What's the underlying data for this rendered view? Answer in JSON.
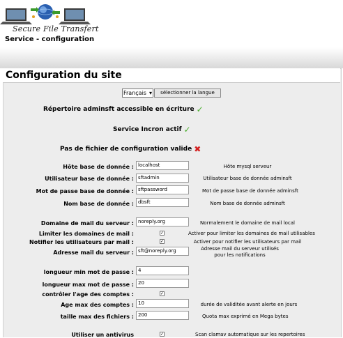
{
  "header": {
    "logo_text": "Secure File Transfert",
    "subtitle": "Service - configuration"
  },
  "panel": {
    "title": "Configuration du site",
    "language": {
      "selected": "Français",
      "button": "sélectionner la langue"
    }
  },
  "status": [
    {
      "text": "Répertoire adminsft accessible en écriture",
      "state": "ok",
      "icon": "check-icon"
    },
    {
      "text": "Service Incron actif",
      "state": "ok",
      "icon": "check-icon"
    },
    {
      "text": "Pas de fichier de configuration valide",
      "state": "error",
      "icon": "cross-icon"
    }
  ],
  "db": {
    "host": {
      "label": "Hôte base de donnée :",
      "value": "localhost",
      "help": "Hôte mysql serveur"
    },
    "user": {
      "label": "Utilisateur base de donnée :",
      "value": "sftadmin",
      "help": "Utilisateur base de donnée adminsft"
    },
    "password": {
      "label": "Mot de passe base de donnée :",
      "value": "sftpassword",
      "help": "Mot de passe base de donnée adminsft"
    },
    "name": {
      "label": "Nom base de donnée :",
      "value": "dbsft",
      "help": "Nom base de donnée adminsft"
    }
  },
  "mail": {
    "domain": {
      "label": "Domaine de mail du serveur :",
      "value": "noreply.org",
      "help": "Normalement le domaine de mail local"
    },
    "limit": {
      "label": "Limiter les domaines de mail :",
      "checked": true,
      "help": "Activer pour limiter les domaines de mail utilisables"
    },
    "notify": {
      "label": "Notifier les utilisateurs par mail :",
      "checked": true,
      "help": "Activer pour notifier les utilisateurs par mail"
    },
    "address": {
      "label": "Adresse mail du serveur :",
      "value": "sft@noreply.org",
      "help": "Adresse mail du serveur utilisés pour les notifications"
    }
  },
  "limits": {
    "pw_min": {
      "label": "longueur min mot de passe :",
      "value": "4"
    },
    "pw_max": {
      "label": "longueur max mot de passe :",
      "value": "20"
    },
    "age_check": {
      "label": "contrôler l'age des comptes :",
      "checked": true
    },
    "age_max": {
      "label": "Age max des comptes :",
      "value": "10",
      "help": "durée de validitée avant alerte en jours"
    },
    "size_max": {
      "label": "taille max des fichiers :",
      "value": "200",
      "help": "Quota max exprimé en Mega bytes"
    },
    "antivirus": {
      "label": "Utiliser un antivirus",
      "checked": true,
      "help": "Scan clamav automatique sur les repertoires"
    }
  },
  "check_mark": "✓",
  "colors": {
    "ok": "#4caf2f",
    "error": "#d42020",
    "panel_bg": "#ededed"
  }
}
